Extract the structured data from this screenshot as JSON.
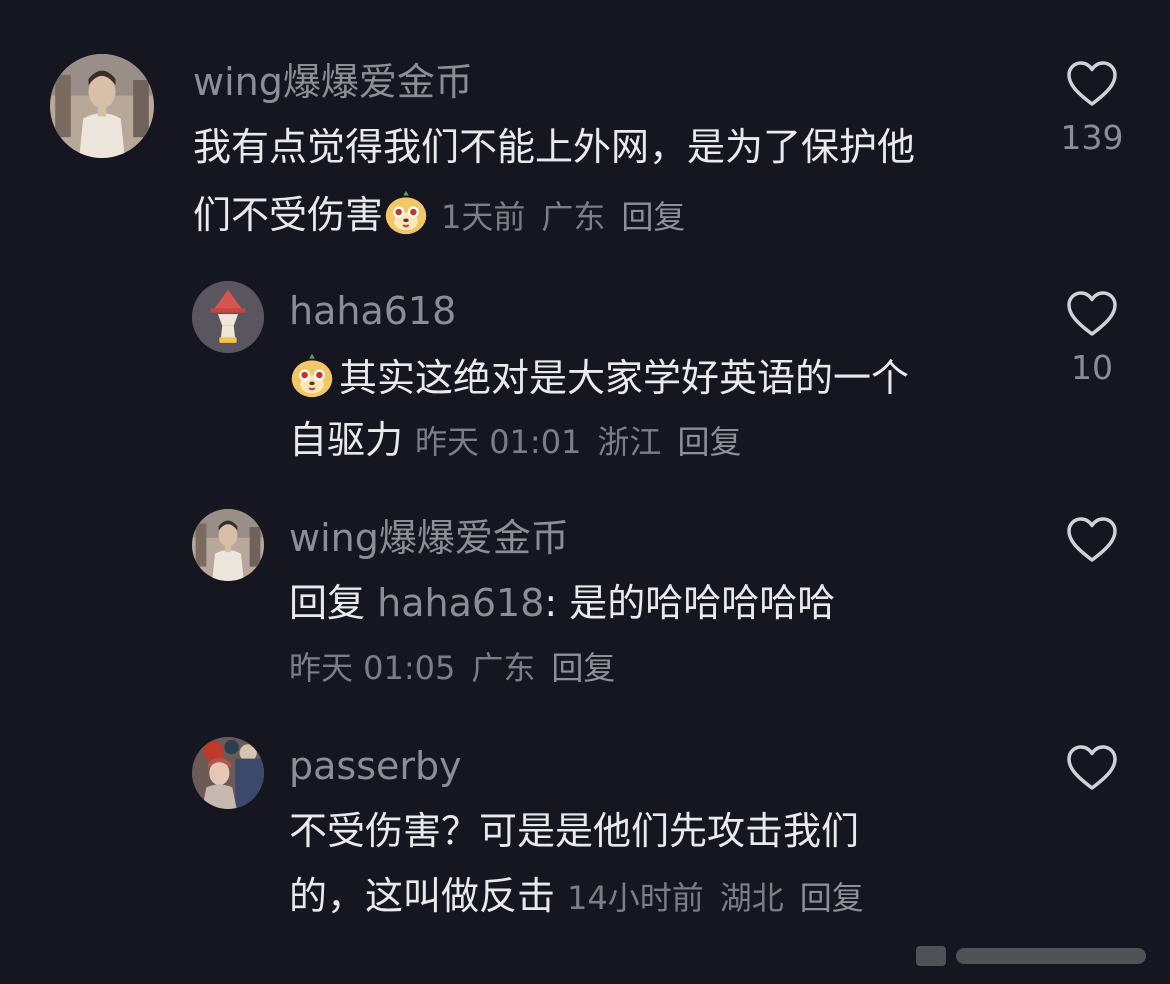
{
  "comments": [
    {
      "username": "wing爆爆爱金币",
      "line1": "我有点觉得我们不能上外网，是为了保护他",
      "line2": "们不受伤害",
      "emoji": "dog-face-emoji",
      "time": "1天前",
      "location": "广东",
      "reply": "回复",
      "likes": "139"
    },
    {
      "username": "haha618",
      "emoji": "dog-face-emoji",
      "line1": "其实这绝对是大家学好英语的一个",
      "line2": "自驱力",
      "time": "昨天 01:01",
      "location": "浙江",
      "reply": "回复",
      "likes": "10"
    },
    {
      "username": "wing爆爆爱金币",
      "reply_prefix": "回复",
      "mention": "haha618",
      "text": ": 是的哈哈哈哈哈",
      "time": "昨天 01:05",
      "location": "广东",
      "reply": "回复"
    },
    {
      "username": "passerby",
      "line1": "不受伤害？可是是他们先攻击我们",
      "line2": "的，这叫做反击",
      "time": "14小时前",
      "location": "湖北",
      "reply": "回复"
    }
  ],
  "colors": {
    "background": "#161620",
    "text": "#e9e9ee",
    "muted": "#8d8d95"
  },
  "icons": [
    "heart-outline-icon",
    "dog-face-emoji"
  ]
}
